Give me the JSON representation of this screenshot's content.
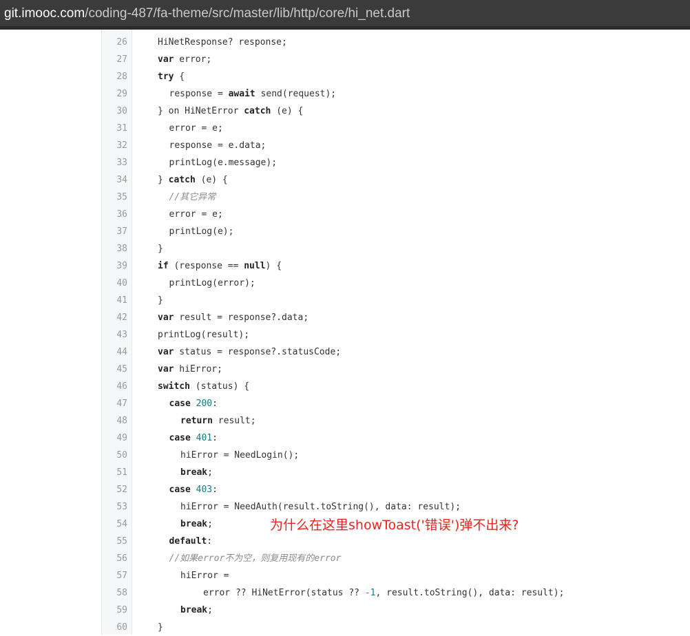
{
  "url": {
    "domain": "git.imooc.com",
    "path": "/coding-487/fa-theme/src/master/lib/http/core/hi_net.dart"
  },
  "code_lines": [
    {
      "n": "26",
      "indent": 2,
      "tokens": [
        [
          "p",
          "HiNetResponse? response;"
        ]
      ]
    },
    {
      "n": "27",
      "indent": 2,
      "tokens": [
        [
          "k",
          "var"
        ],
        [
          "p",
          " error;"
        ]
      ]
    },
    {
      "n": "28",
      "indent": 2,
      "tokens": [
        [
          "k",
          "try"
        ],
        [
          "p",
          " {"
        ]
      ]
    },
    {
      "n": "29",
      "indent": 4,
      "tokens": [
        [
          "p",
          "response = "
        ],
        [
          "k",
          "await"
        ],
        [
          "p",
          " send(request);"
        ]
      ]
    },
    {
      "n": "30",
      "indent": 2,
      "tokens": [
        [
          "p",
          "} on HiNetError "
        ],
        [
          "k",
          "catch"
        ],
        [
          "p",
          " (e) {"
        ]
      ]
    },
    {
      "n": "31",
      "indent": 4,
      "tokens": [
        [
          "p",
          "error = e;"
        ]
      ]
    },
    {
      "n": "32",
      "indent": 4,
      "tokens": [
        [
          "p",
          "response = e.data;"
        ]
      ]
    },
    {
      "n": "33",
      "indent": 4,
      "tokens": [
        [
          "p",
          "printLog(e.message);"
        ]
      ]
    },
    {
      "n": "34",
      "indent": 2,
      "tokens": [
        [
          "p",
          "} "
        ],
        [
          "k",
          "catch"
        ],
        [
          "p",
          " (e) {"
        ]
      ]
    },
    {
      "n": "35",
      "indent": 4,
      "tokens": [
        [
          "c",
          "//其它异常"
        ]
      ]
    },
    {
      "n": "36",
      "indent": 4,
      "tokens": [
        [
          "p",
          "error = e;"
        ]
      ]
    },
    {
      "n": "37",
      "indent": 4,
      "tokens": [
        [
          "p",
          "printLog(e);"
        ]
      ]
    },
    {
      "n": "38",
      "indent": 2,
      "tokens": [
        [
          "p",
          "}"
        ]
      ]
    },
    {
      "n": "39",
      "indent": 2,
      "tokens": [
        [
          "k",
          "if"
        ],
        [
          "p",
          " (response == "
        ],
        [
          "k",
          "null"
        ],
        [
          "p",
          ") {"
        ]
      ]
    },
    {
      "n": "40",
      "indent": 4,
      "tokens": [
        [
          "p",
          "printLog(error);"
        ]
      ]
    },
    {
      "n": "41",
      "indent": 2,
      "tokens": [
        [
          "p",
          "}"
        ]
      ]
    },
    {
      "n": "42",
      "indent": 2,
      "tokens": [
        [
          "k",
          "var"
        ],
        [
          "p",
          " result = response?.data;"
        ]
      ]
    },
    {
      "n": "43",
      "indent": 2,
      "tokens": [
        [
          "p",
          "printLog(result);"
        ]
      ]
    },
    {
      "n": "44",
      "indent": 2,
      "tokens": [
        [
          "k",
          "var"
        ],
        [
          "p",
          " status = response?.statusCode;"
        ]
      ]
    },
    {
      "n": "45",
      "indent": 2,
      "tokens": [
        [
          "k",
          "var"
        ],
        [
          "p",
          " hiError;"
        ]
      ]
    },
    {
      "n": "46",
      "indent": 2,
      "tokens": [
        [
          "k",
          "switch"
        ],
        [
          "p",
          " (status) {"
        ]
      ]
    },
    {
      "n": "47",
      "indent": 4,
      "tokens": [
        [
          "k",
          "case"
        ],
        [
          "p",
          " "
        ],
        [
          "n",
          "200"
        ],
        [
          "p",
          ":"
        ]
      ]
    },
    {
      "n": "48",
      "indent": 6,
      "tokens": [
        [
          "k",
          "return"
        ],
        [
          "p",
          " result;"
        ]
      ]
    },
    {
      "n": "49",
      "indent": 4,
      "tokens": [
        [
          "k",
          "case"
        ],
        [
          "p",
          " "
        ],
        [
          "n",
          "401"
        ],
        [
          "p",
          ":"
        ]
      ]
    },
    {
      "n": "50",
      "indent": 6,
      "tokens": [
        [
          "p",
          "hiError = NeedLogin();"
        ]
      ]
    },
    {
      "n": "51",
      "indent": 6,
      "tokens": [
        [
          "k",
          "break"
        ],
        [
          "p",
          ";"
        ]
      ]
    },
    {
      "n": "52",
      "indent": 4,
      "tokens": [
        [
          "k",
          "case"
        ],
        [
          "p",
          " "
        ],
        [
          "n",
          "403"
        ],
        [
          "p",
          ":"
        ]
      ]
    },
    {
      "n": "53",
      "indent": 6,
      "tokens": [
        [
          "p",
          "hiError = NeedAuth(result.toString(), data: result);"
        ]
      ]
    },
    {
      "n": "54",
      "indent": 6,
      "tokens": [
        [
          "k",
          "break"
        ],
        [
          "p",
          ";"
        ]
      ]
    },
    {
      "n": "55",
      "indent": 4,
      "tokens": [
        [
          "k",
          "default"
        ],
        [
          "p",
          ":"
        ]
      ]
    },
    {
      "n": "56",
      "indent": 4,
      "tokens": [
        [
          "c",
          "//如果error不为空，则复用现有的error"
        ]
      ]
    },
    {
      "n": "57",
      "indent": 6,
      "tokens": [
        [
          "p",
          "hiError ="
        ]
      ]
    },
    {
      "n": "58",
      "indent": 10,
      "tokens": [
        [
          "p",
          "error ?? HiNetError(status ?? "
        ],
        [
          "n",
          "-1"
        ],
        [
          "p",
          ", result.toString(), data: result);"
        ]
      ]
    },
    {
      "n": "59",
      "indent": 6,
      "tokens": [
        [
          "k",
          "break"
        ],
        [
          "p",
          ";"
        ]
      ]
    },
    {
      "n": "60",
      "indent": 2,
      "tokens": [
        [
          "p",
          "}"
        ]
      ]
    }
  ],
  "annotation": "为什么在这里showToast('错误')弹不出来?",
  "colors": {
    "url_bar_bg": "#3b3b3b",
    "gutter_bg": "#f6f7f8",
    "line_number": "#999999",
    "number_literal": "#0f7b83",
    "comment": "#8c8c8c",
    "annotation": "#e8231d"
  }
}
